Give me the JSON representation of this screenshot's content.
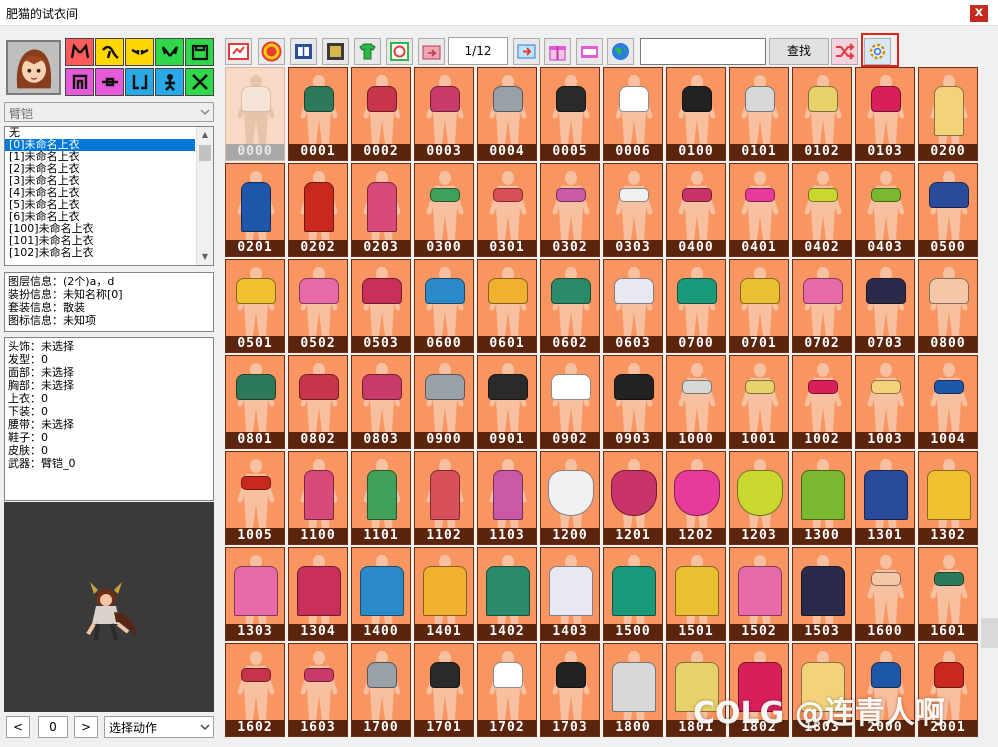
{
  "window": {
    "title": "肥猫的试衣间",
    "close_label": "x"
  },
  "left": {
    "category_buttons": [
      {
        "icon": "cat-ears-icon",
        "color": "#ff5b5b"
      },
      {
        "icon": "ponytail-icon",
        "color": "#ffd800"
      },
      {
        "icon": "eyes-icon",
        "color": "#ffd800"
      },
      {
        "icon": "wings-icon",
        "color": "#2fd84a"
      },
      {
        "icon": "shirt-icon",
        "color": "#2fd84a"
      },
      {
        "icon": "pants-icon",
        "color": "#e55ad9"
      },
      {
        "icon": "belt-icon",
        "color": "#e55ad9"
      },
      {
        "icon": "shoes-icon",
        "color": "#29a9e8"
      },
      {
        "icon": "figure-icon",
        "color": "#29a9e8"
      },
      {
        "icon": "crossed-swords-icon",
        "color": "#2fd84a"
      }
    ],
    "part_select": "臂铠",
    "list_items": [
      "无",
      "[0]未命名上衣",
      "[1]未命名上衣",
      "[2]未命名上衣",
      "[3]未命名上衣",
      "[4]未命名上衣",
      "[5]未命名上衣",
      "[6]未命名上衣",
      "[100]未命名上衣",
      "[101]未命名上衣",
      "[102]未命名上衣"
    ],
    "selected_index": 1,
    "info_lines": [
      "图层信息：(2个)a，d",
      "装扮信息：未知名称[0]",
      "套装信息：散装",
      "图标信息：未知项"
    ],
    "slot_lines": [
      "头饰：未选择",
      "发型：0",
      "面部：未选择",
      "胸部：未选择",
      "上衣：0",
      "下装：0",
      "腰带：未选择",
      "鞋子：0",
      "皮肤：0",
      "武器：臂铠_0"
    ],
    "frame_prev": "<",
    "frame_value": "0",
    "frame_next": ">",
    "action_select": "选择动作"
  },
  "toolbar": {
    "buttons": [
      {
        "icon": "size-icon",
        "color": "#e33b3b"
      },
      {
        "icon": "tn-icon",
        "color": "#e33b3b"
      },
      {
        "icon": "book-icon",
        "color": "#3a6fc4"
      },
      {
        "icon": "film-icon",
        "color": "#4a4a4a"
      },
      {
        "icon": "shirt-add-icon",
        "color": "#2fb84a"
      },
      {
        "icon": "refresh-icon",
        "color": "#e33b3b"
      },
      {
        "icon": "folder-export-icon",
        "color": "#e33b3b"
      },
      {
        "icon": "next-page-icon",
        "color": "#e33b3b"
      },
      {
        "icon": "gift-icon",
        "color": "#e55ad9"
      },
      {
        "icon": "npk-icon",
        "color": "#e55ad9"
      },
      {
        "icon": "globe-icon",
        "color": "#2a7de1"
      }
    ],
    "page_counter": "1/12",
    "search_placeholder": "",
    "search_label": "查找",
    "shuffle_icon": "shuffle-icon",
    "settings_icon": "gear-icon"
  },
  "grid_codes": [
    "0000",
    "0001",
    "0002",
    "0003",
    "0004",
    "0005",
    "0006",
    "0100",
    "0101",
    "0102",
    "0103",
    "0200",
    "0201",
    "0202",
    "0203",
    "0300",
    "0301",
    "0302",
    "0303",
    "0400",
    "0401",
    "0402",
    "0403",
    "0500",
    "0501",
    "0502",
    "0503",
    "0600",
    "0601",
    "0602",
    "0603",
    "0700",
    "0701",
    "0702",
    "0703",
    "0800",
    "0801",
    "0802",
    "0803",
    "0900",
    "0901",
    "0902",
    "0903",
    "1000",
    "1001",
    "1002",
    "1003",
    "1004",
    "1005",
    "1100",
    "1101",
    "1102",
    "1103",
    "1200",
    "1201",
    "1202",
    "1203",
    "1300",
    "1301",
    "1302",
    "1303",
    "1304",
    "1400",
    "1401",
    "1402",
    "1403",
    "1500",
    "1501",
    "1502",
    "1503",
    "1600",
    "1601",
    "1602",
    "1603",
    "1700",
    "1701",
    "1702",
    "1703",
    "1800",
    "1801",
    "1802",
    "1803",
    "2000",
    "2001"
  ],
  "watermark": "COLG @连青人啊"
}
